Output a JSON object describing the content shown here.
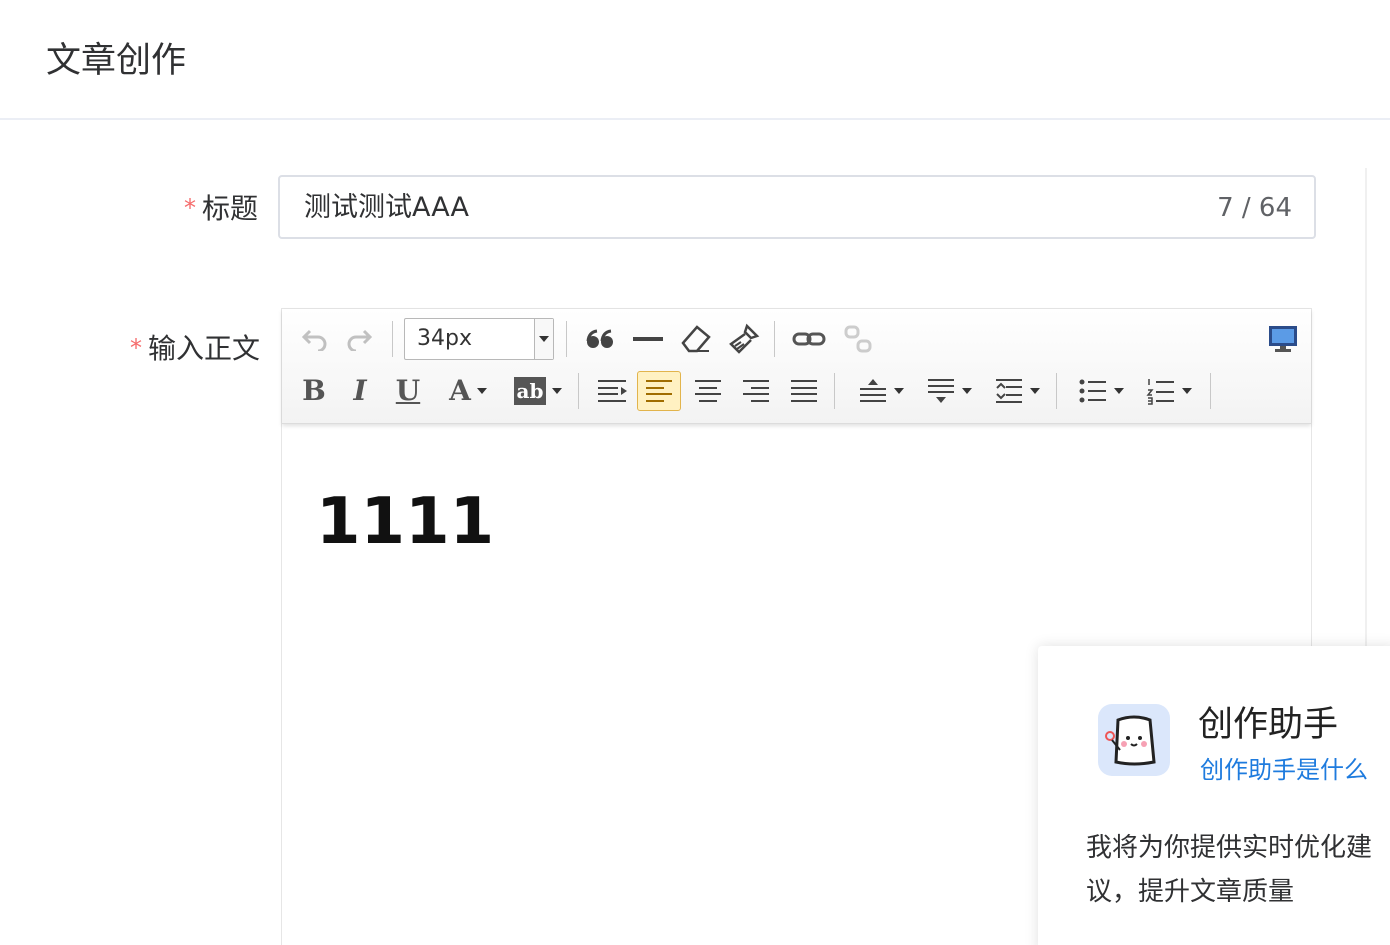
{
  "header": {
    "title": "文章创作"
  },
  "form": {
    "title_label": "标题",
    "body_label": "输入正文",
    "required_mark": "*",
    "title_value": "测试测试AAA",
    "title_count": "7 / 64"
  },
  "toolbar": {
    "font_size": "34px",
    "bold_letter": "B",
    "italic_letter": "I",
    "underline_letter": "U",
    "font_color_letter": "A",
    "highlight_letter": "ab"
  },
  "editor": {
    "content": "1111"
  },
  "assistant": {
    "title": "创作助手",
    "link": "创作助手是什么",
    "description": "我将为你提供实时优化建议，提升文章质量"
  },
  "colors": {
    "required": "#f56c6c",
    "link": "#1e7bde",
    "active_bg": "#fff1c2"
  }
}
